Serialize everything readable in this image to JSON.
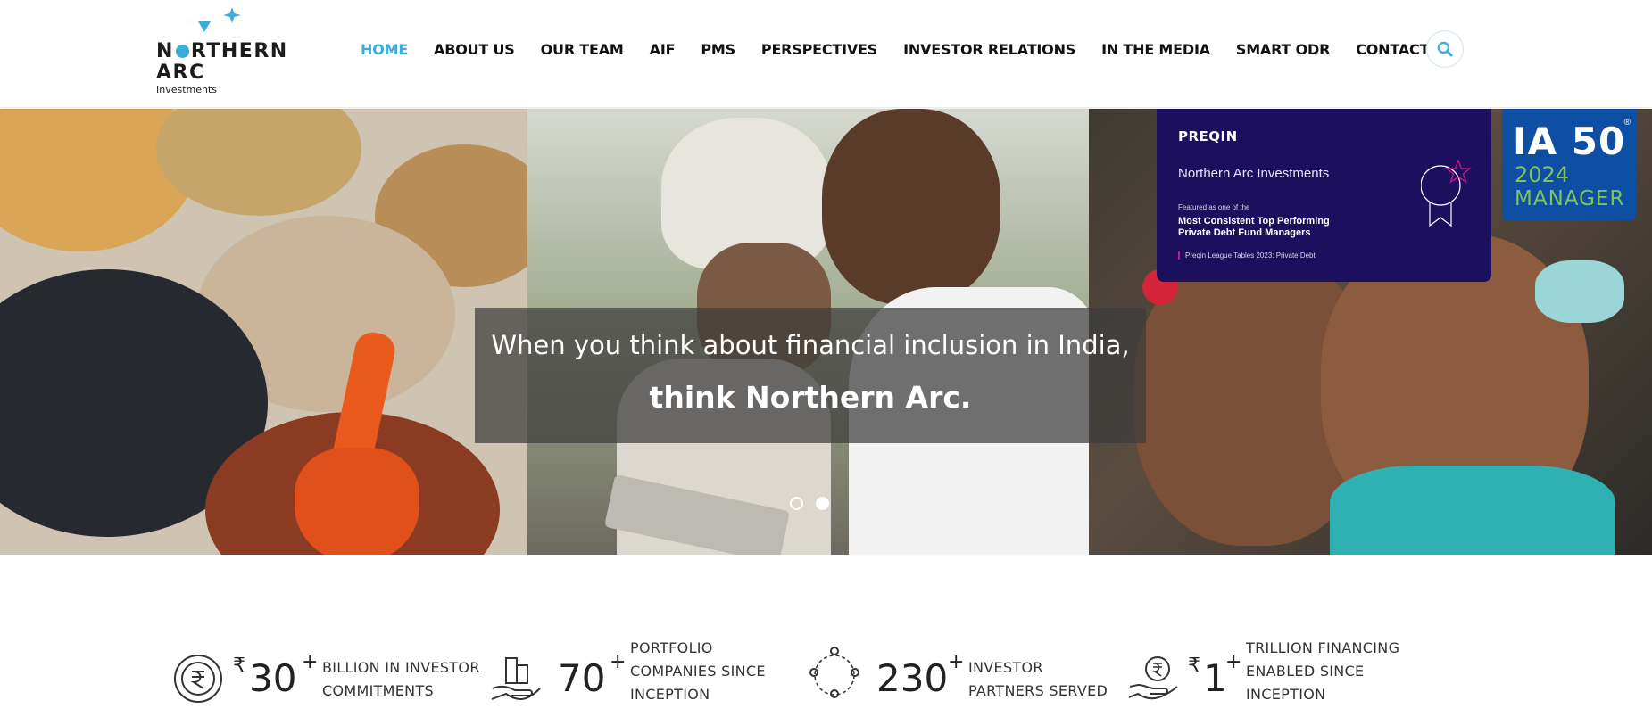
{
  "logo": {
    "name_line1_pre": "N",
    "name_line1_post": "RTHERN",
    "name_line2": "ARC",
    "sub": "Investments"
  },
  "nav": {
    "items": [
      {
        "label": "HOME",
        "active": true
      },
      {
        "label": "ABOUT US",
        "active": false
      },
      {
        "label": "OUR TEAM",
        "active": false
      },
      {
        "label": "AIF",
        "active": false
      },
      {
        "label": "PMS",
        "active": false
      },
      {
        "label": "PERSPECTIVES",
        "active": false
      },
      {
        "label": "INVESTOR RELATIONS",
        "active": false
      },
      {
        "label": "IN THE MEDIA",
        "active": false
      },
      {
        "label": "SMART ODR",
        "active": false
      },
      {
        "label": "CONTACT US",
        "active": false
      }
    ],
    "search_icon": "search-icon",
    "accent_color": "#3aaed8"
  },
  "hero": {
    "tagline_line1": "When you think about financial inclusion in India,",
    "tagline_line2": "think Northern Arc.",
    "slides": 2,
    "active_slide": 2
  },
  "preqin": {
    "brand": "PREQIN",
    "firm": "Northern Arc Investments",
    "featured": "Featured as one of the",
    "award_line1": "Most Consistent Top Performing",
    "award_line2": "Private Debt Fund Managers",
    "league": "Preqin League Tables 2023: Private Debt",
    "bg_color": "#1b0f5e"
  },
  "ia50": {
    "title": "IA 50",
    "reg": "®",
    "year": "2024",
    "label": "MANAGER"
  },
  "stats": [
    {
      "currency": "₹",
      "value": "30",
      "plus": "+",
      "label_line1": "BILLION IN INVESTOR",
      "label_line2": "COMMITMENTS",
      "label_line3": "",
      "icon": "rupee-circle-icon"
    },
    {
      "currency": "",
      "value": "70",
      "plus": "+",
      "label_line1": "PORTFOLIO",
      "label_line2": "COMPANIES SINCE",
      "label_line3": "INCEPTION",
      "icon": "buildings-in-hand-icon"
    },
    {
      "currency": "",
      "value": "230",
      "plus": "+",
      "label_line1": "INVESTOR",
      "label_line2": "PARTNERS SERVED",
      "label_line3": "",
      "icon": "people-network-icon"
    },
    {
      "currency": "₹",
      "value": "1",
      "plus": "+",
      "label_line1": "TRILLION FINANCING",
      "label_line2": "ENABLED SINCE",
      "label_line3": "INCEPTION",
      "icon": "rupee-hand-icon"
    }
  ]
}
